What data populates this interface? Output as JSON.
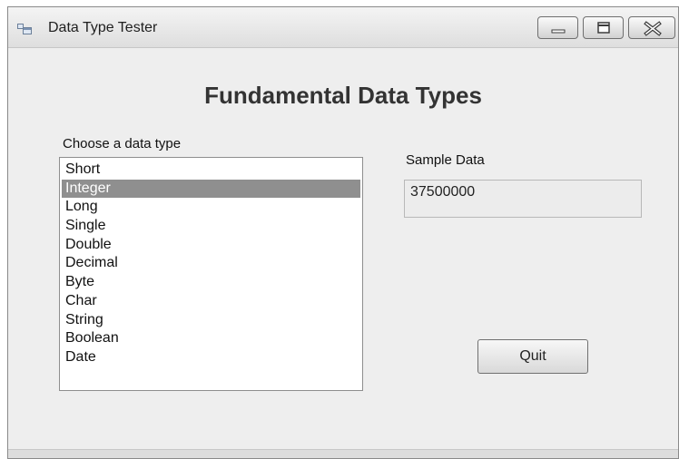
{
  "window": {
    "title": "Data Type Tester",
    "caption_buttons": {
      "minimize_icon": "minimize-icon",
      "maximize_icon": "maximize-icon",
      "close_icon": "close-icon"
    }
  },
  "form": {
    "heading": "Fundamental Data Types",
    "choose_label": "Choose a data type",
    "data_types": [
      "Short",
      "Integer",
      "Long",
      "Single",
      "Double",
      "Decimal",
      "Byte",
      "Char",
      "String",
      "Boolean",
      "Date"
    ],
    "selected_type": "Integer",
    "sample_label": "Sample Data",
    "sample_value": "37500000",
    "quit_label": "Quit"
  },
  "colors": {
    "selection": "#8f8f8f",
    "window_bg": "#eeeeee"
  }
}
